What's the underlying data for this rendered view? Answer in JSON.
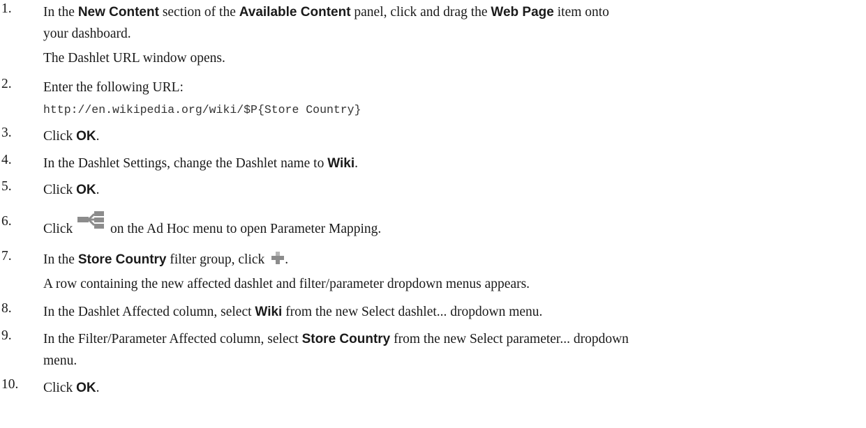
{
  "steps": [
    {
      "num": "1.",
      "segments": [
        "In the ",
        "New Content",
        " section of the ",
        "Available Content",
        " panel, click and drag the ",
        "Web Page",
        " item onto"
      ],
      "line2": "your dashboard.",
      "note": "The Dashlet URL window opens."
    },
    {
      "num": "2.",
      "text": "Enter the following URL:",
      "code": "http://en.wikipedia.org/wiki/$P{Store Country}"
    },
    {
      "num": "3.",
      "pre": "Click ",
      "bold": "OK",
      "post": "."
    },
    {
      "num": "4.",
      "pre": "In the Dashlet Settings, change the Dashlet name to ",
      "bold": "Wiki",
      "post": "."
    },
    {
      "num": "5.",
      "pre": "Click ",
      "bold": "OK",
      "post": "."
    },
    {
      "num": "6.",
      "pre": "Click",
      "icon": "parameter-mapping-icon",
      "post": "on the Ad Hoc menu to open Parameter Mapping."
    },
    {
      "num": "7.",
      "pre": "In the ",
      "bold": "Store Country",
      "mid": " filter group, click",
      "icon": "plus-icon",
      "post": ".",
      "note": "A row containing the new affected dashlet and filter/parameter dropdown menus appears."
    },
    {
      "num": "8.",
      "pre": "In the Dashlet Affected column, select ",
      "bold": "Wiki",
      "post": " from the new Select dashlet... dropdown menu."
    },
    {
      "num": "9.",
      "pre": "In the Filter/Parameter Affected column, select ",
      "bold": "Store Country",
      "post": " from the new Select parameter... dropdown",
      "line2": "menu."
    },
    {
      "num": "10.",
      "pre": "Click ",
      "bold": "OK",
      "post": "."
    }
  ],
  "colors": {
    "icon_gray": "#8c8c8c",
    "icon_light": "#b5b5b5",
    "text": "#1a1a1a"
  }
}
